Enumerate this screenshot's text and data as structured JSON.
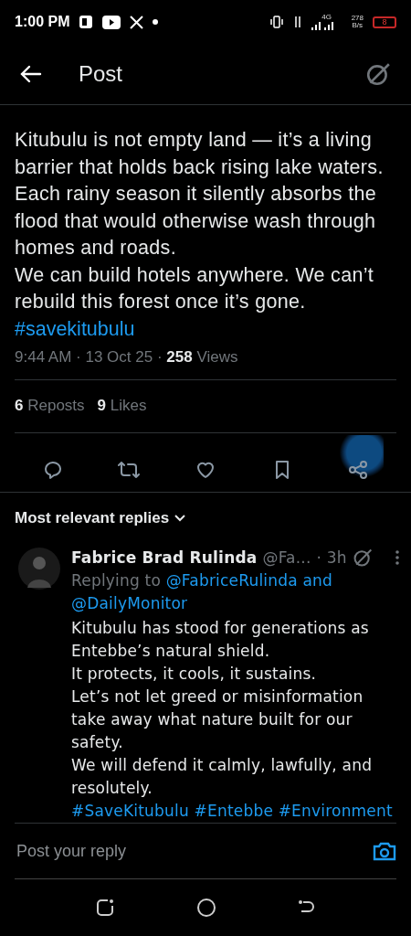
{
  "status_bar": {
    "time": "1:00 PM",
    "network": "4G",
    "speed": "278",
    "speed_unit": "B/s",
    "battery": "8"
  },
  "header": {
    "title": "Post"
  },
  "post": {
    "text": "Kitubulu is not empty land — it’s a living barrier that holds back rising lake waters. Each rainy season it silently absorbs the flood that would otherwise wash through homes and roads.\nWe can build hotels anywhere. We can’t rebuild this forest once it’s gone.",
    "hashtags": "#savekitubulu",
    "timestamp": "9:44 AM · 13 Oct 25 · ",
    "views_count": "258",
    "views_label": " Views",
    "stats": [
      {
        "count": "6",
        "label": "Reposts"
      },
      {
        "count": "9",
        "label": "Likes"
      }
    ],
    "actions": [
      {
        "kind": "reply",
        "highlighted": false
      },
      {
        "kind": "repost",
        "highlighted": false
      },
      {
        "kind": "like",
        "highlighted": false
      },
      {
        "kind": "bookmark",
        "highlighted": false
      },
      {
        "kind": "share",
        "highlighted": true
      }
    ]
  },
  "replies_sort": {
    "label": "Most relevant replies"
  },
  "replies": [
    {
      "name": "Fabrice Brad Rulinda",
      "handle": "@Fa...",
      "time": "· 3h",
      "replying_label": "Replying to",
      "replying_to": "@FabriceRulinda and @DailyMonitor",
      "text": "Kitubulu has stood for generations as Entebbe’s natural shield.\nIt protects, it cools, it sustains.\nLet’s not let greed or misinformation take away what nature built for our safety.\nWe will defend it  calmly, lawfully, and resolutely.",
      "hashtags": "#SaveKitubulu #Entebbe #Environment"
    }
  ],
  "composer": {
    "placeholder": "Post your reply"
  }
}
